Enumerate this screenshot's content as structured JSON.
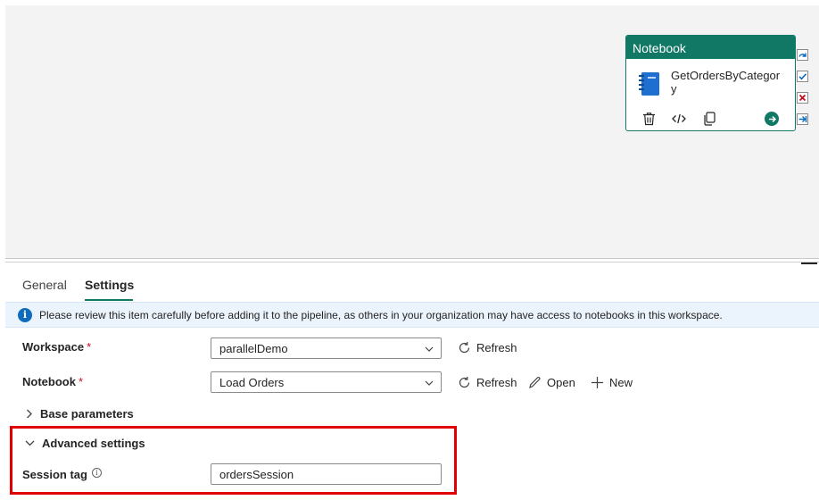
{
  "activity": {
    "type_label": "Notebook",
    "name": "GetOrdersByCategory",
    "actions": [
      "delete-icon",
      "code-icon",
      "copy-icon",
      "run-icon"
    ],
    "side_icons": [
      "skip-icon",
      "success-icon",
      "failure-icon",
      "completion-icon"
    ]
  },
  "tabs": [
    {
      "label": "General",
      "active": false
    },
    {
      "label": "Settings",
      "active": true
    }
  ],
  "banner": {
    "text": "Please review this item carefully before adding it to the pipeline, as others in your organization may have access to notebooks in this workspace."
  },
  "form": {
    "workspace": {
      "label": "Workspace",
      "required_mark": "*",
      "value": "parallelDemo",
      "refresh_label": "Refresh"
    },
    "notebook": {
      "label": "Notebook",
      "required_mark": "*",
      "value": "Load Orders",
      "refresh_label": "Refresh",
      "open_label": "Open",
      "new_label": "New"
    },
    "base_parameters": {
      "label": "Base parameters",
      "expanded": false
    },
    "advanced_settings": {
      "label": "Advanced settings",
      "expanded": true
    },
    "session_tag": {
      "label": "Session tag",
      "value": "ordersSession"
    }
  },
  "colors": {
    "accent": "#117865",
    "info": "#0f6cbd",
    "highlight": "#e00000"
  }
}
